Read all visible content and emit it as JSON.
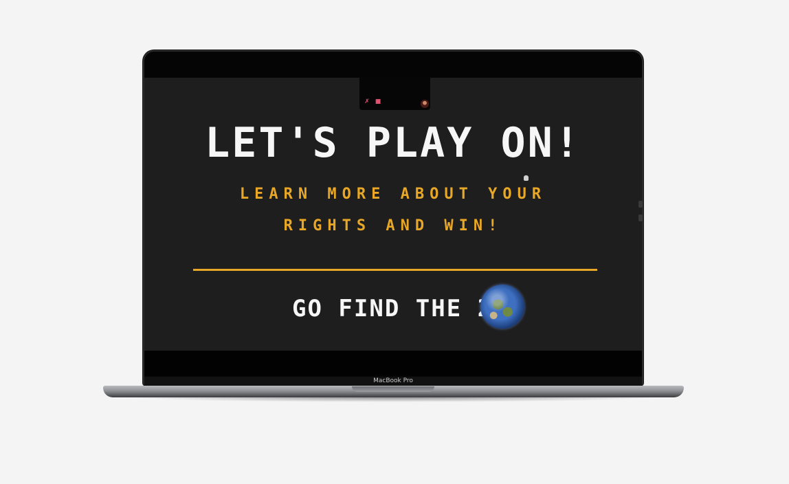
{
  "slide": {
    "headline": "LET'S PLAY ON!",
    "subtitle_line1": "LEARN MORE ABOUT YOUR",
    "subtitle_line2": "RIGHTS AND WIN!",
    "call_to_action": "GO FIND THE 2",
    "accent_color": "#e8a726",
    "background_color": "#1e1e1e",
    "text_color": "#f6f6f6"
  },
  "meeting_bar": {
    "icons": [
      "mic-muted-icon",
      "camera-off-icon"
    ],
    "participant_avatar": "avatar"
  },
  "device": {
    "model_label": "MacBook Pro"
  }
}
